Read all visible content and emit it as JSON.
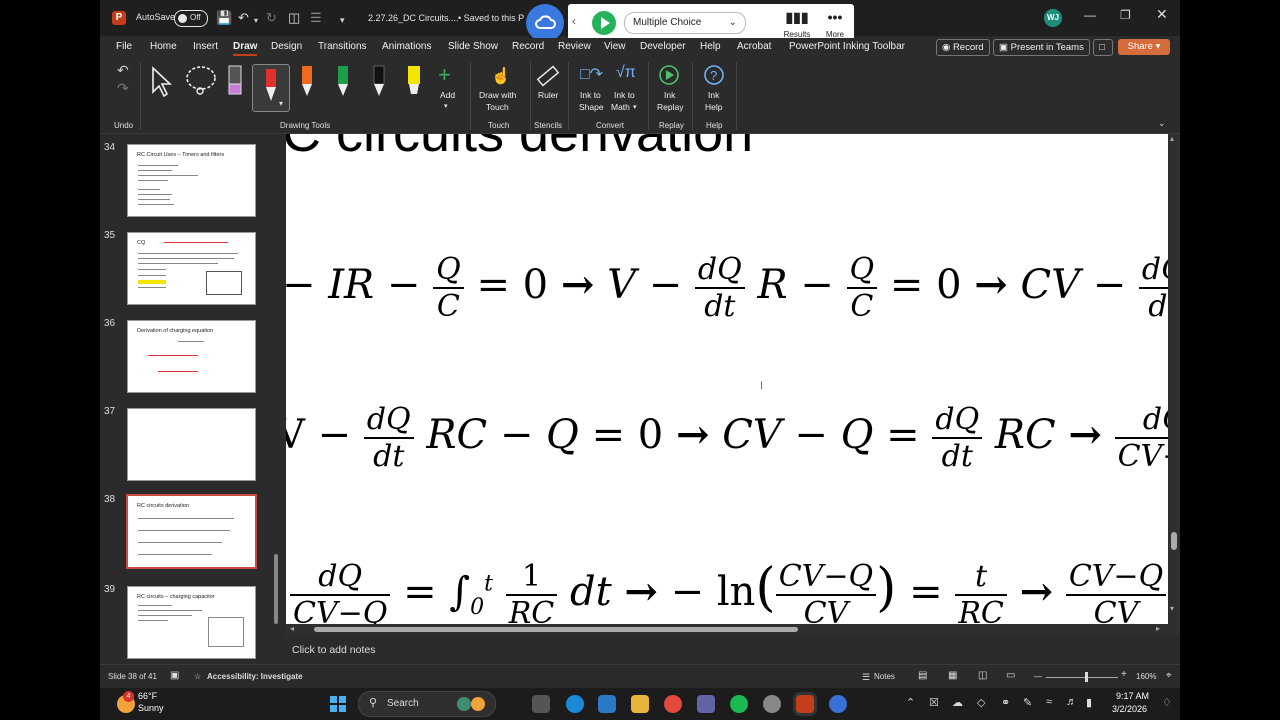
{
  "titlebar": {
    "autosave_label": "AutoSave",
    "autosave_state": "Off",
    "doc_title": "2.27.26_DC Circuits....",
    "save_status": "• Saved to this P",
    "user_initials": "WJ"
  },
  "poll_toolbar": {
    "question_type": "Multiple Choice",
    "results_label": "Results",
    "more_label": "More"
  },
  "menu": {
    "tabs": [
      "File",
      "Home",
      "Insert",
      "Draw",
      "Design",
      "Transitions",
      "Animations",
      "Slide Show",
      "Record",
      "Review",
      "View",
      "Developer",
      "Help",
      "Acrobat",
      "PowerPoint Inking Toolbar"
    ],
    "active_tab": "Draw",
    "record_button": "Record",
    "teams_button": "Present in Teams",
    "share_button": "Share"
  },
  "ribbon": {
    "groups": {
      "undo": "Undo",
      "drawing_tools": "Drawing Tools",
      "touch": "Touch",
      "stencils": "Stencils",
      "convert": "Convert",
      "replay": "Replay",
      "help": "Help"
    },
    "buttons": {
      "add": "Add",
      "draw_with_touch_1": "Draw with",
      "draw_with_touch_2": "Touch",
      "ruler": "Ruler",
      "ink_to_shape_1": "Ink to",
      "ink_to_shape_2": "Shape",
      "ink_to_math_1": "Ink to",
      "ink_to_math_2": "Math",
      "ink_replay_1": "Ink",
      "ink_replay_2": "Replay",
      "ink_help_1": "Ink",
      "ink_help_2": "Help"
    },
    "pen_colors": [
      "#e03030",
      "#f06a1e",
      "#1e9e4a",
      "#111111",
      "#f2e600"
    ]
  },
  "slides": [
    {
      "num": "34",
      "title": "RC Circuit Uses – Timers and filters"
    },
    {
      "num": "35",
      "title": "CQ"
    },
    {
      "num": "36",
      "title": "Derivation of charging equation"
    },
    {
      "num": "37",
      "title": ""
    },
    {
      "num": "38",
      "title": "RC circuits derivation"
    },
    {
      "num": "39",
      "title": "RC circuits – charging capacitor"
    }
  ],
  "selected_slide": "38",
  "slide": {
    "title": "C circuits derivation"
  },
  "notes_placeholder": "Click to add notes",
  "status": {
    "slide_counter": "Slide 38 of 41",
    "accessibility": "Accessibility: Investigate",
    "notes": "Notes",
    "zoom": "160%"
  },
  "taskbar": {
    "temperature": "66°F",
    "weather": "Sunny",
    "search_placeholder": "Search",
    "time": "9:17 AM",
    "date": "3/2/2026",
    "notification_count": "4"
  }
}
